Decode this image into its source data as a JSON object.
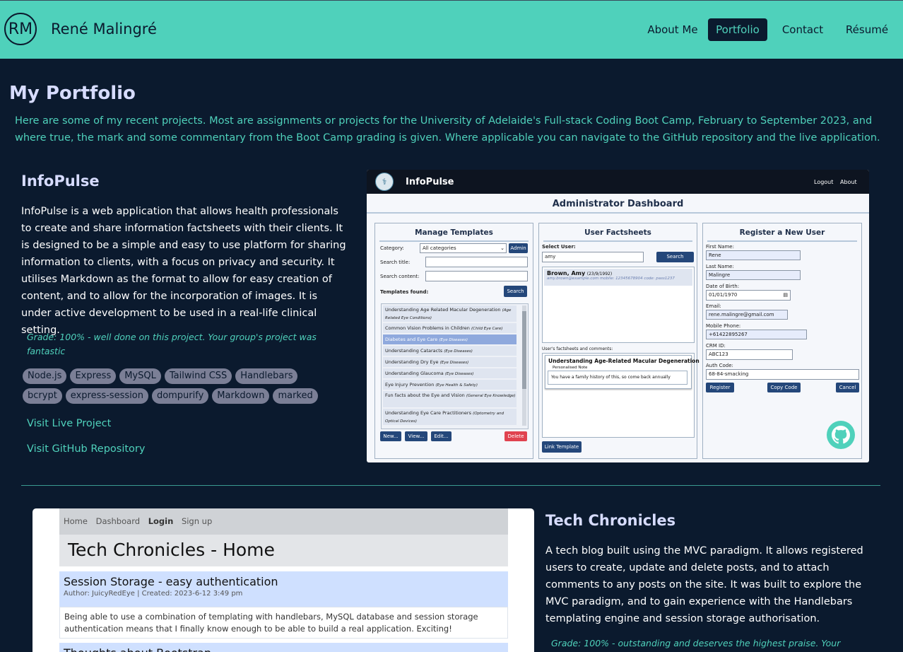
{
  "header": {
    "logo": "RM",
    "name": "René Malingré",
    "nav": [
      {
        "label": "About Me",
        "active": false
      },
      {
        "label": "Portfolio",
        "active": true
      },
      {
        "label": "Contact",
        "active": false
      },
      {
        "label": "Résumé",
        "active": false
      }
    ]
  },
  "page": {
    "title": "My Portfolio",
    "intro": "Here are some of my recent projects. Most are assignments or projects for the University of Adelaide's Full-stack Coding Boot Camp, February to September 2023, and where true, the mark and some commentary from the Boot Camp grading is given. Where applicable you can navigate to the GitHub repository and the live application."
  },
  "projects": [
    {
      "title": "InfoPulse",
      "description": "InfoPulse is a web application that allows health professionals to create and share information factsheets with their clients. It is designed to be a simple and easy to use platform for sharing information to clients, with a focus on privacy and security. It utilises Markdown as the format to allow for easy creation of content, and to allow for the incorporation of images. It is under active development to be used in a real-life clinical setting.",
      "grade": "Grade: 100% - well done on this project. Your group's project was fantastic",
      "tags": [
        "Node.js",
        "Express",
        "MySQL",
        "Tailwind CSS",
        "Handlebars",
        "bcrypt",
        "express-session",
        "dompurify",
        "Markdown",
        "marked"
      ],
      "live_link": "Visit Live Project",
      "repo_link": "Visit GitHub Repository"
    },
    {
      "title": "Tech Chronicles",
      "description": "A tech blog built using the MVC paradigm. It allows registered users to create, update and delete posts, and to attach comments to any posts on the site. It was built to explore the MVC paradigm, and to gain experience with the Handlebars templating engine and session storage authorisation.",
      "grade": "Grade: 100% - outstanding and deserves the highest praise. Your"
    }
  ],
  "shot1": {
    "brand": "InfoPulse",
    "logout": "Logout",
    "about": "About",
    "dashboard": "Administrator Dashboard",
    "templates": {
      "heading": "Manage Templates",
      "category_label": "Category:",
      "category_value": "All categories",
      "admin_btn": "Admin",
      "search_title_label": "Search title:",
      "search_content_label": "Search content:",
      "found_label": "Templates found:",
      "search_btn": "Search",
      "items": [
        {
          "name": "Understanding Age Related Macular Degeneration",
          "cat": "(Age Related Eye Conditions)"
        },
        {
          "name": "Common Vision Problems in Children",
          "cat": "(Child Eye Care)"
        },
        {
          "name": "Diabetes and Eye Care",
          "cat": "(Eye Diseases)"
        },
        {
          "name": "Understanding Cataracts",
          "cat": "(Eye Diseases)"
        },
        {
          "name": "Understanding Dry Eye",
          "cat": "(Eye Diseases)"
        },
        {
          "name": "Understanding Glaucoma",
          "cat": "(Eye Diseases)"
        },
        {
          "name": "Eye Injury Prevention",
          "cat": "(Eye Health & Safety)"
        },
        {
          "name": "Fun facts about the Eye and Vision",
          "cat": "(General Eye Knowledge)"
        },
        {
          "name": "Understanding Eye Care Practitioners",
          "cat": "(Optometry and Optical Devices)"
        }
      ],
      "new_btn": "New...",
      "view_btn": "View...",
      "edit_btn": "Edit...",
      "delete_btn": "Delete"
    },
    "factsheets": {
      "heading": "User Factsheets",
      "select_label": "Select User:",
      "select_value": "amy",
      "search_btn": "Search",
      "user_name": "Brown, Amy",
      "user_dob": "(23/9/1992)",
      "user_detail": "amy.brown@example.com mobile: 12345678904 code: pass1237",
      "comments_label": "User's factsheets and comments:",
      "sheet_title": "Understanding Age-Related Macular Degeneration",
      "note_label": "Personalised Note",
      "note_text": "You have a family history of this, so come back annually",
      "link_btn": "Link Template"
    },
    "register": {
      "heading": "Register a New User",
      "fields": [
        {
          "label": "First Name:",
          "value": "Rene"
        },
        {
          "label": "Last Name:",
          "value": "Malingre"
        },
        {
          "label": "Date of Birth:",
          "value": "01/01/1970"
        },
        {
          "label": "Email:",
          "value": "rene.malingre@gmail.com"
        },
        {
          "label": "Mobile Phone:",
          "value": "+61422895267"
        },
        {
          "label": "CRM ID:",
          "value": "ABC123"
        },
        {
          "label": "Auth Code:",
          "value": "68-84-smacking"
        }
      ],
      "register_btn": "Register",
      "copy_btn": "Copy Code",
      "cancel_btn": "Cancel"
    }
  },
  "shot2": {
    "nav": [
      "Home",
      "Dashboard",
      "Login",
      "Sign up"
    ],
    "heading": "Tech Chronicles - Home",
    "posts": [
      {
        "title": "Session Storage - easy authentication",
        "meta": "Author: JuicyRedEye | Created: 2023-6-12 3:49 pm",
        "body": "Being able to use a combination of templating with handlebars, MySQL database and session storage authentication means that I finally know enough to be able to build a real application. Exciting!"
      },
      {
        "title": "Thoughts about Bootstrap"
      }
    ]
  }
}
